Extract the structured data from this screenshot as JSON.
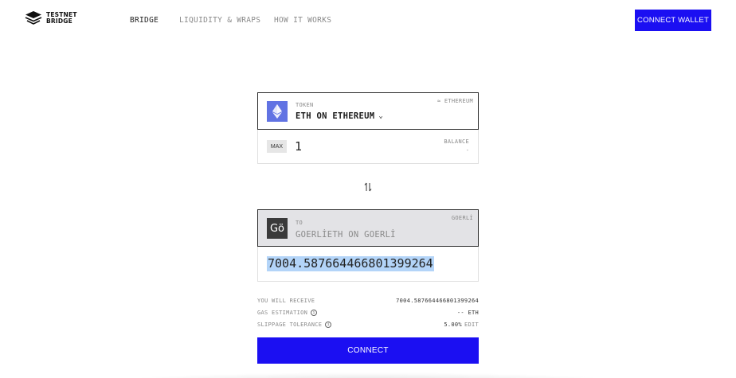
{
  "brand": {
    "line1": "TESTNET",
    "line2": "BRIDGE",
    "logo_icon": "layered-cube-logo"
  },
  "nav": [
    {
      "label": "BRIDGE",
      "active": true
    },
    {
      "label": "LIQUIDITY & WRAPS",
      "active": false
    },
    {
      "label": "HOW IT WORKS",
      "active": false
    }
  ],
  "header": {
    "wallet_label": "CONNECT WALLET"
  },
  "from": {
    "token_label": "TOKEN",
    "network": "≈ ETHEREUM",
    "token_name": "ETH ON ETHEREUM",
    "icon": "ethereum-icon",
    "max_label": "MAX",
    "amount": "1",
    "balance_label": "BALANCE",
    "balance_value": "-"
  },
  "to": {
    "to_label": "TO",
    "network": "GOERLİ",
    "token_name": "GOERLİETH ON GOERLİ",
    "icon_text": "Gö",
    "receive_value": "7004.587664466801399264"
  },
  "summary": {
    "receive_label": "YOU WILL RECEIVE",
    "receive_value": "7004.587664466801399264",
    "gas_label": "GAS ESTIMATION",
    "gas_value": "-- ETH",
    "slippage_label": "SLIPPAGE TOLERANCE",
    "slippage_value": "5.00%",
    "edit_label": "EDIT"
  },
  "connect_label": "CONNECT",
  "colors": {
    "accent": "#1b0ff2",
    "eth": "#6173e3",
    "selection": "#b3d4f8"
  }
}
